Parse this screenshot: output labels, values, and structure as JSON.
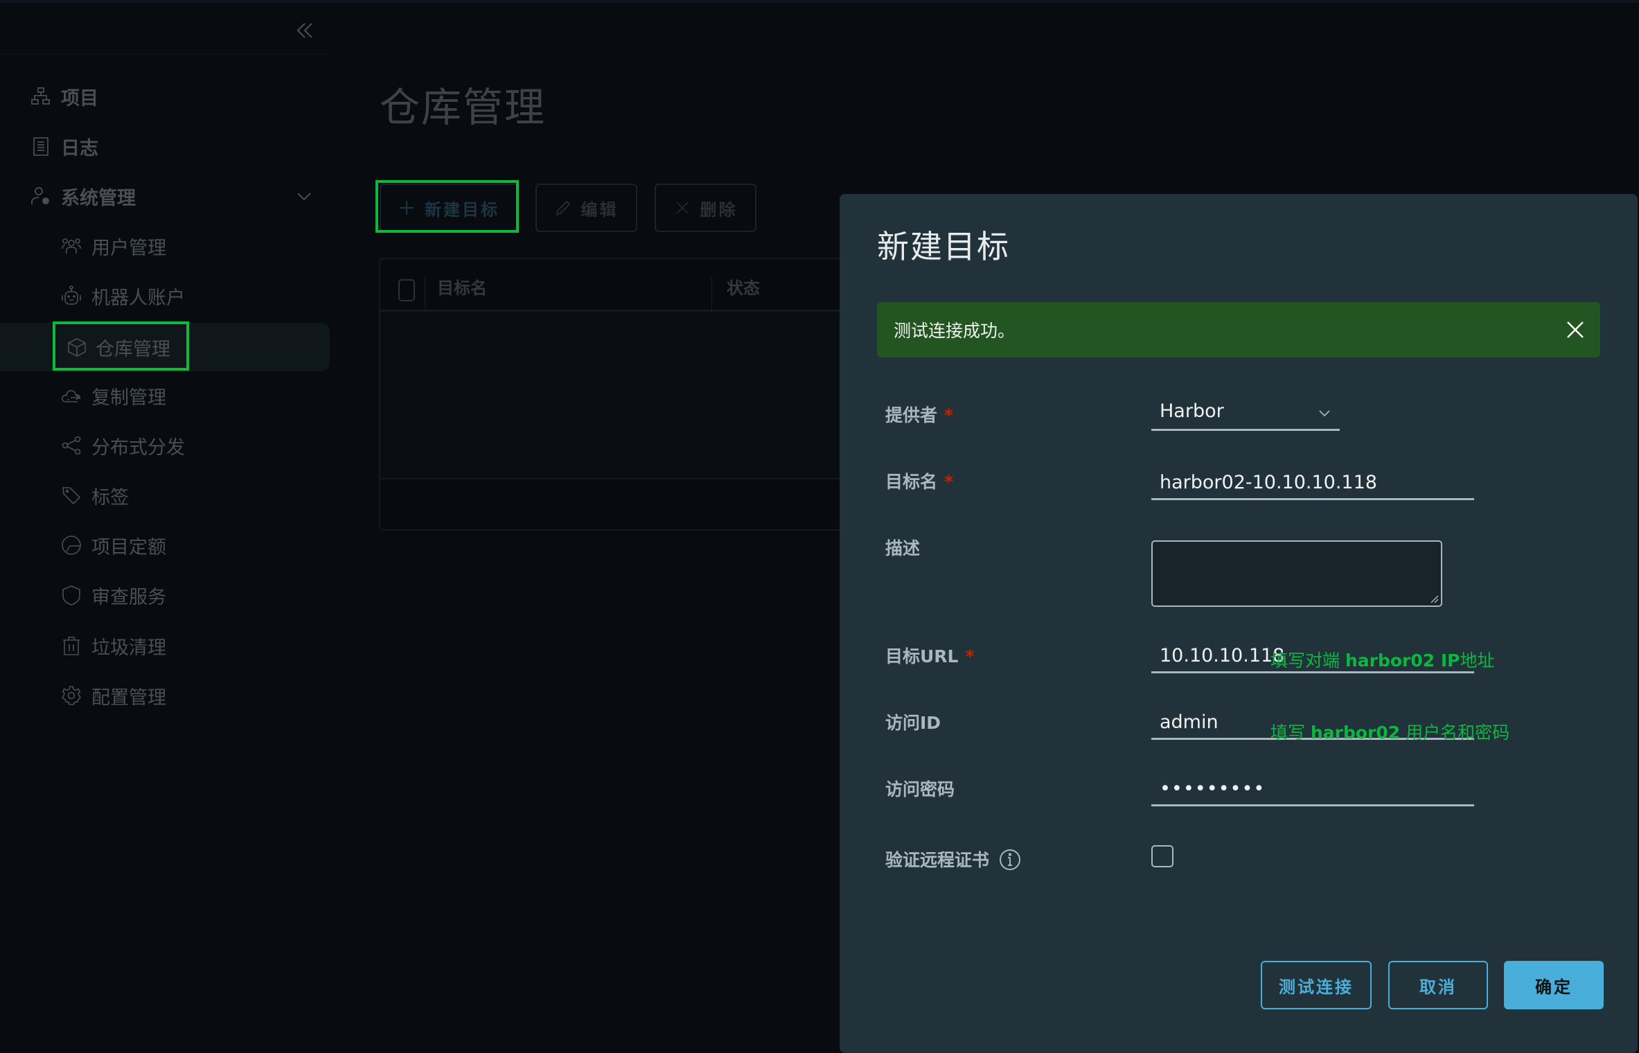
{
  "sidebar": {
    "collapse_icon": "double-chevron-left-icon",
    "items": [
      {
        "label": "项目",
        "icon": "project-hierarchy-icon"
      },
      {
        "label": "日志",
        "icon": "log-document-icon"
      },
      {
        "label": "系统管理",
        "icon": "user-settings-icon",
        "expanded": true
      },
      {
        "label": "用户管理",
        "icon": "users-icon"
      },
      {
        "label": "机器人账户",
        "icon": "robot-icon"
      },
      {
        "label": "仓库管理",
        "icon": "cube-icon",
        "active": true
      },
      {
        "label": "复制管理",
        "icon": "cloud-sync-icon"
      },
      {
        "label": "分布式分发",
        "icon": "share-icon"
      },
      {
        "label": "标签",
        "icon": "tag-icon"
      },
      {
        "label": "项目定额",
        "icon": "pie-gauge-icon"
      },
      {
        "label": "审查服务",
        "icon": "shield-icon"
      },
      {
        "label": "垃圾清理",
        "icon": "trash-icon"
      },
      {
        "label": "配置管理",
        "icon": "gear-icon"
      }
    ]
  },
  "main": {
    "page_title": "仓库管理",
    "toolbar": {
      "new_label": "新建目标",
      "edit_label": "编辑",
      "delete_label": "删除"
    },
    "table": {
      "columns": [
        "目标名",
        "状态"
      ],
      "rows": []
    }
  },
  "modal": {
    "title": "新建目标",
    "alert": {
      "type": "success",
      "message": "测试连接成功。"
    },
    "fields": {
      "provider": {
        "label": "提供者",
        "required": true,
        "value": "Harbor"
      },
      "name": {
        "label": "目标名",
        "required": true,
        "value": "harbor02-10.10.10.118"
      },
      "description": {
        "label": "描述",
        "required": false,
        "value": ""
      },
      "url": {
        "label": "目标URL",
        "required": true,
        "value": "10.10.10.118"
      },
      "access_id": {
        "label": "访问ID",
        "required": false,
        "value": "admin"
      },
      "access_secret": {
        "label": "访问密码",
        "required": false,
        "value": "•••••••••"
      },
      "verify_cert": {
        "label": "验证远程证书",
        "checked": false
      }
    },
    "annotations": {
      "url_note": {
        "prefix": "填写对端 ",
        "bold": "harbor02 IP",
        "suffix": "地址"
      },
      "cred_note": {
        "prefix": "填写 ",
        "bold": "harbor02",
        "suffix": " 用户名和密码"
      }
    },
    "footer": {
      "test_label": "测试连接",
      "cancel_label": "取消",
      "ok_label": "确定"
    }
  },
  "colors": {
    "accent": "#49aed9",
    "success_bg": "#225522",
    "annotation": "#0db63f",
    "highlight_box": "#0db83d",
    "required": "#c92100",
    "modal_bg": "#22323a"
  }
}
